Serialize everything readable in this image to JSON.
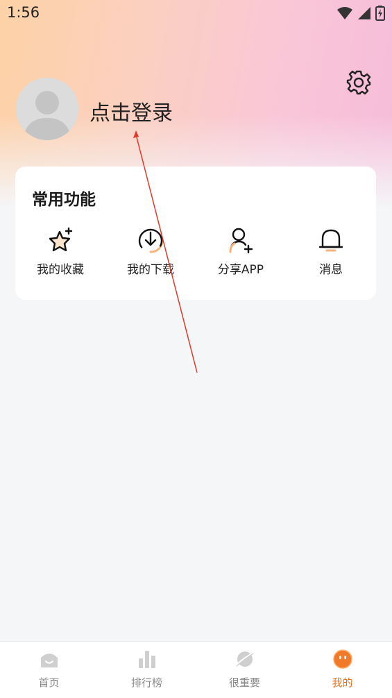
{
  "status_bar": {
    "time": "1:56"
  },
  "profile": {
    "login_label": "点击登录"
  },
  "features_card": {
    "title": "常用功能",
    "items": [
      {
        "label": "我的收藏",
        "icon": "star-plus-icon"
      },
      {
        "label": "我的下载",
        "icon": "download-icon"
      },
      {
        "label": "分享APP",
        "icon": "add-user-icon"
      },
      {
        "label": "消息",
        "icon": "bell-icon"
      }
    ]
  },
  "tab_bar": {
    "items": [
      {
        "label": "首页",
        "icon": "home-icon"
      },
      {
        "label": "排行榜",
        "icon": "bar-chart-icon"
      },
      {
        "label": "很重要",
        "icon": "planet-icon"
      },
      {
        "label": "我的",
        "icon": "face-icon",
        "active": true
      }
    ]
  },
  "colors": {
    "accent": "#e8731f",
    "annotation_arrow": "#e0392b"
  }
}
